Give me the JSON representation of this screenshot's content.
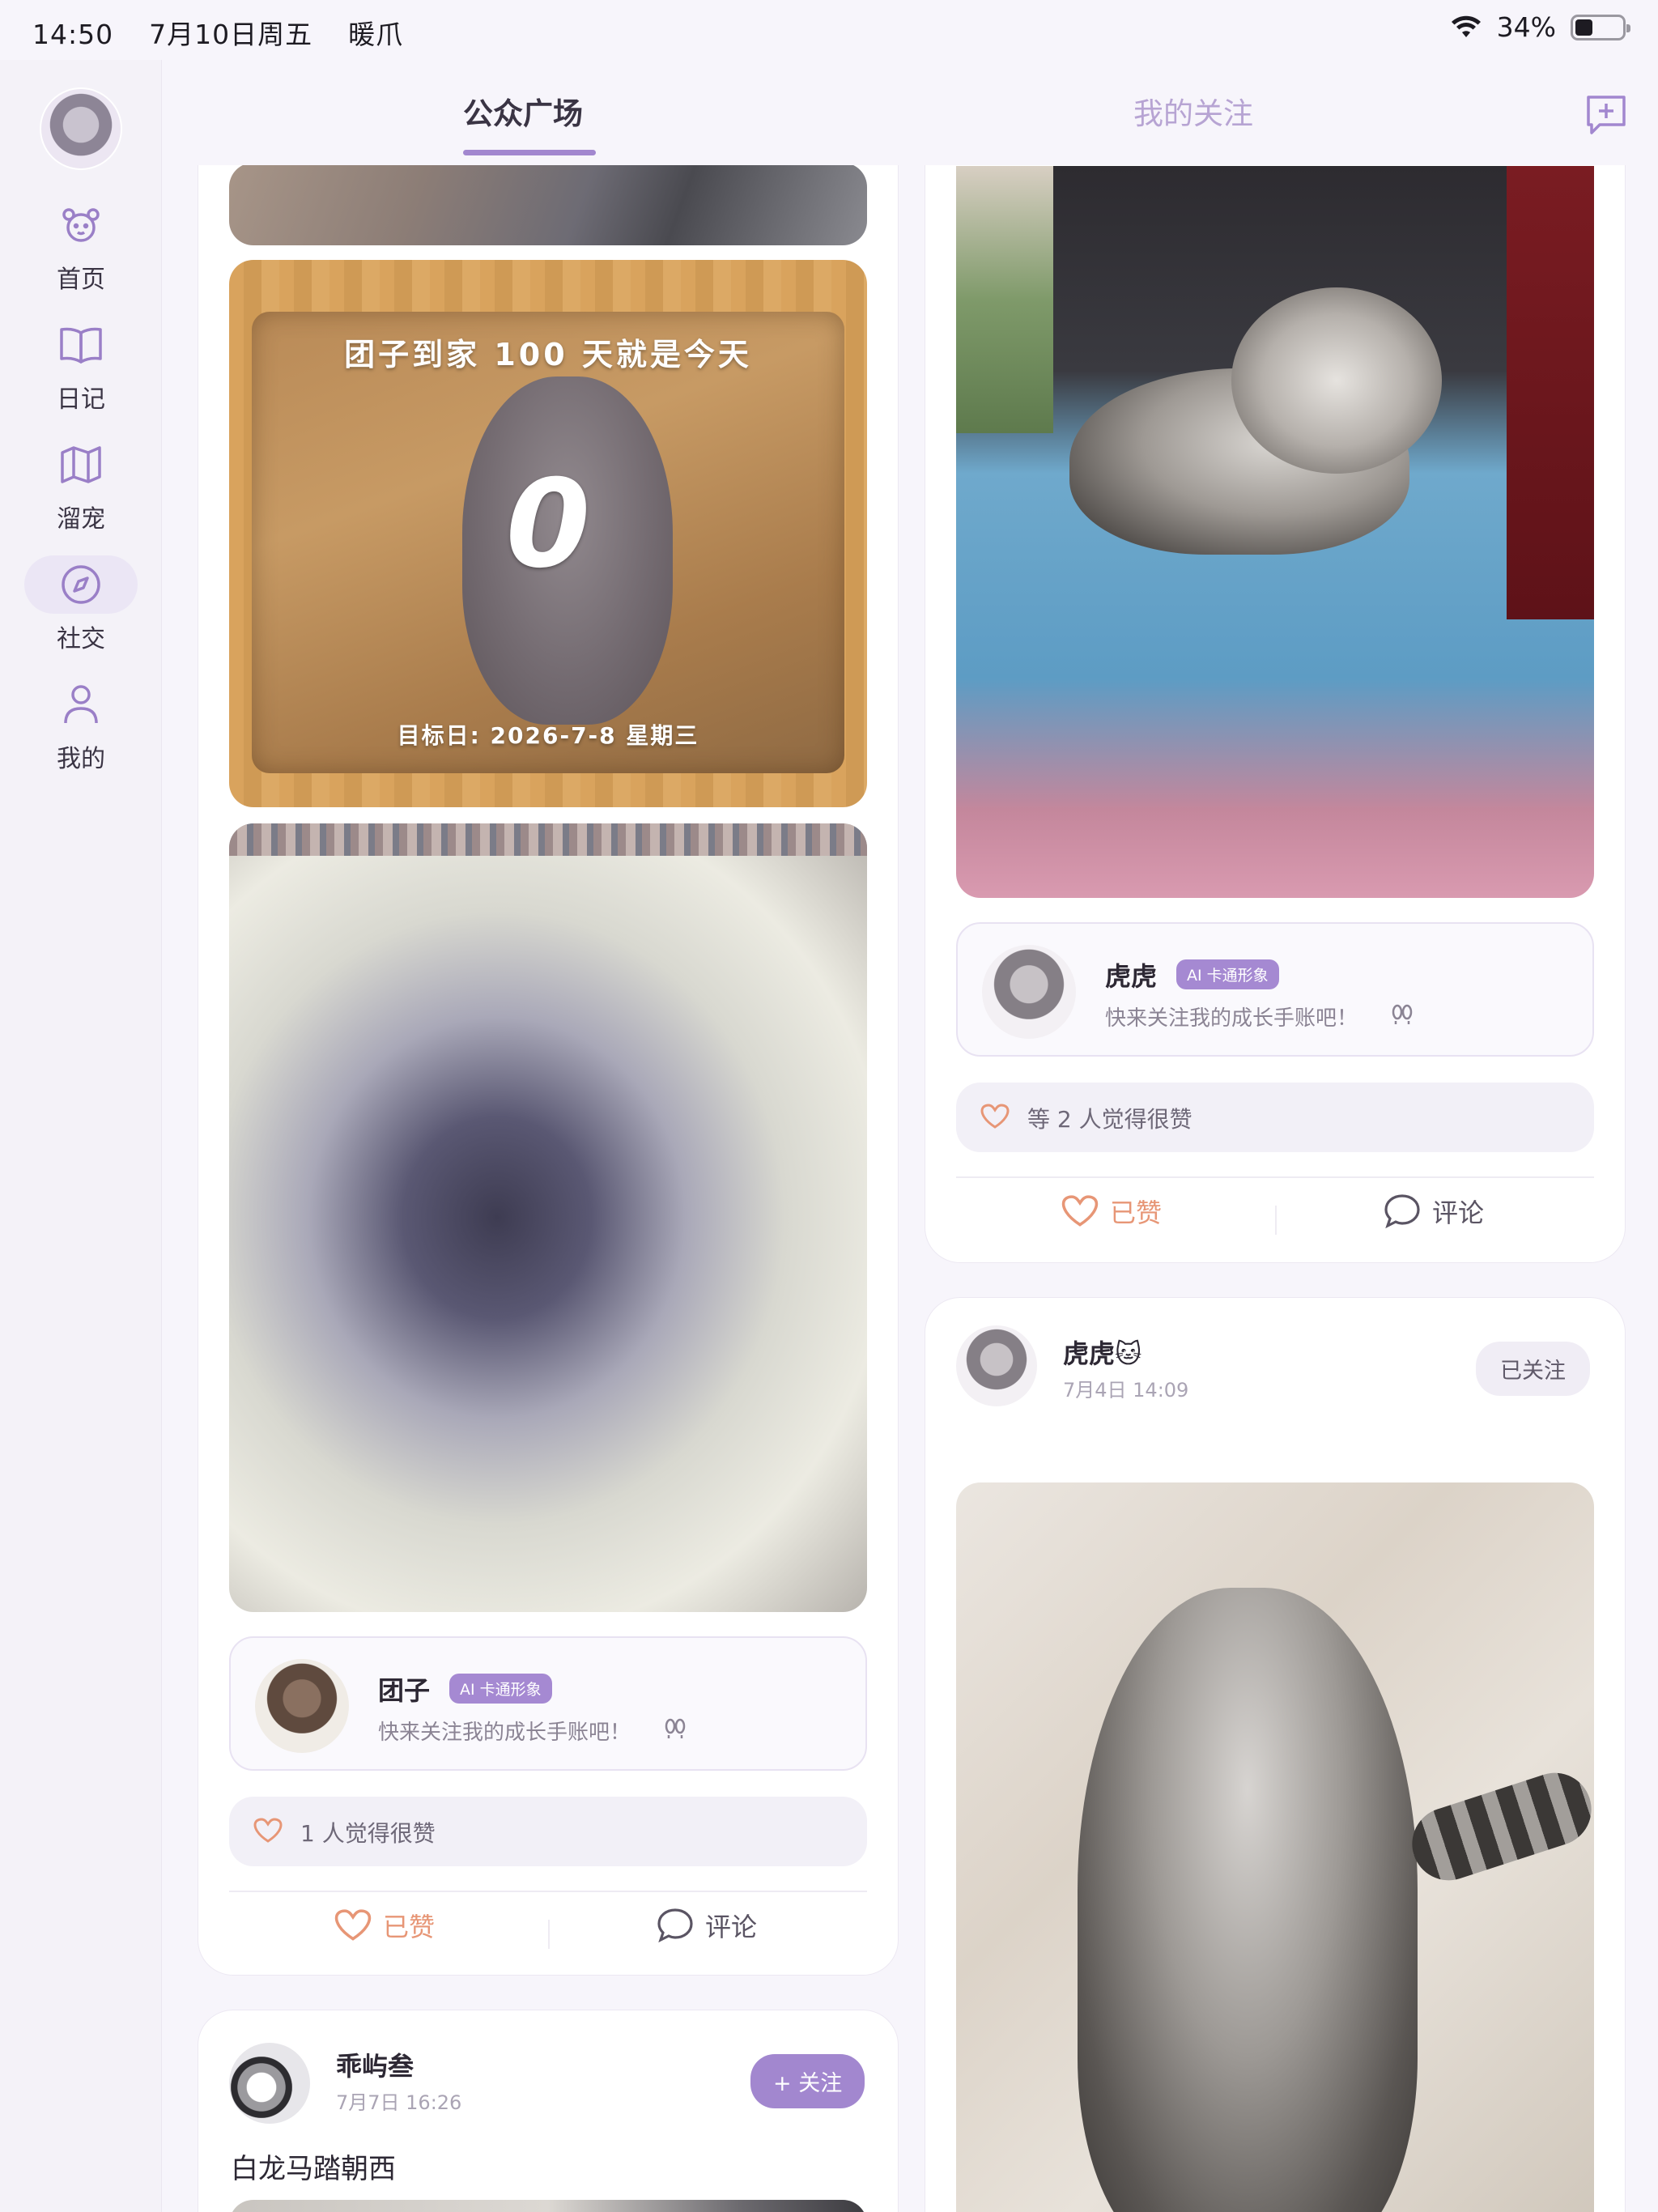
{
  "status_bar": {
    "time": "14:50",
    "date": "7月10日周五",
    "app": "暖爪",
    "battery": "34%",
    "battery_level": 0.34
  },
  "sidebar": {
    "items": [
      {
        "label": "首页",
        "icon": "dog-face-icon"
      },
      {
        "label": "日记",
        "icon": "book-icon"
      },
      {
        "label": "溜宠",
        "icon": "map-icon"
      },
      {
        "label": "社交",
        "icon": "compass-icon",
        "active": true
      },
      {
        "label": "我的",
        "icon": "person-icon"
      }
    ]
  },
  "header": {
    "tabs": [
      {
        "label": "公众广场",
        "active": true
      },
      {
        "label": "我的关注",
        "active": false
      }
    ],
    "new_post_icon": "message-plus-icon"
  },
  "left_column": {
    "countdown": {
      "title": "团子到家 100 天就是今天",
      "days": "0",
      "target": "目标日: 2026-7-8 星期三"
    },
    "profile": {
      "name": "团子",
      "badge": "AI 卡通形象",
      "subtitle": "快来关注我的成长手账吧！"
    },
    "likes": "1 人觉得很赞",
    "actions": {
      "liked": "已赞",
      "comment": "评论"
    },
    "post2": {
      "name": "乖屿叁",
      "time": "7月7日 16:26",
      "follow": "+ 关注",
      "text": "白龙马踏朝西"
    }
  },
  "right_column": {
    "profile": {
      "name": "虎虎",
      "badge": "AI 卡通形象",
      "subtitle": "快来关注我的成长手账吧！"
    },
    "likes": "等 2 人觉得很赞",
    "actions": {
      "liked": "已赞",
      "comment": "评论"
    },
    "post2": {
      "name": "虎虎🐱",
      "time": "7月4日 14:09",
      "follow": "已关注"
    }
  },
  "colors": {
    "accent": "#a287cf",
    "liked": "#e79676",
    "bg": "#f7f5fb"
  }
}
